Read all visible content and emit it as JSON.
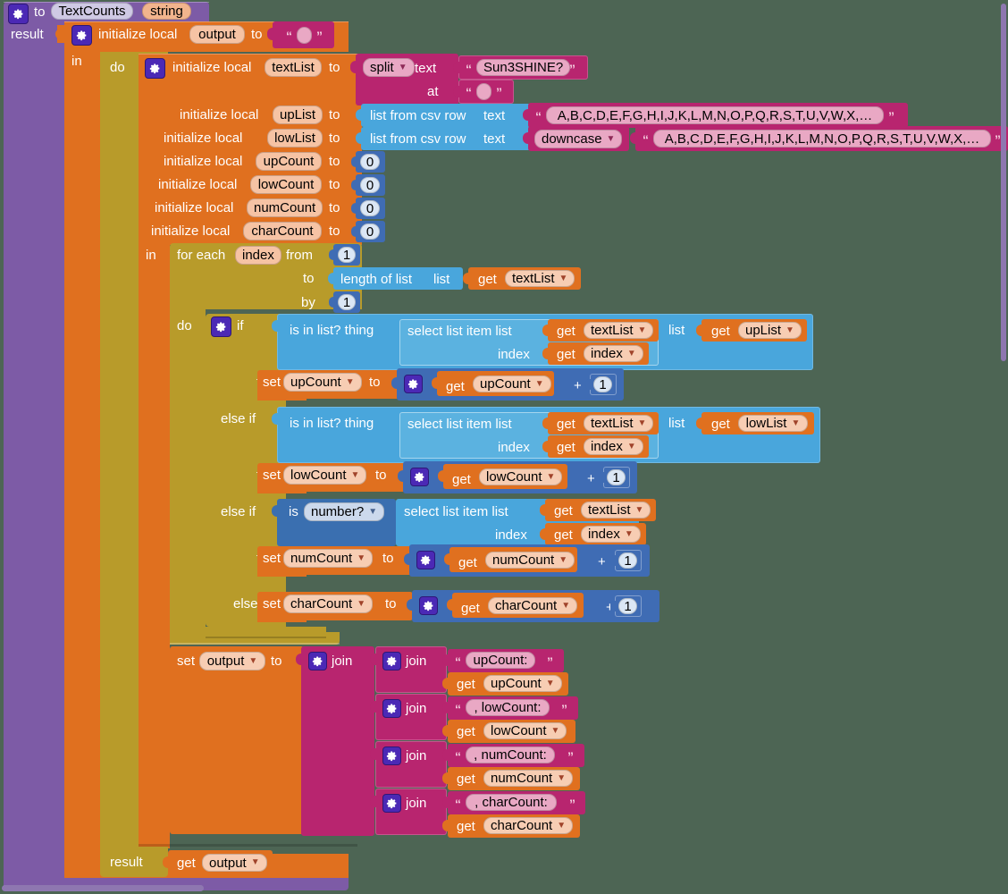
{
  "workspace": {
    "background_color": "#4d6554",
    "kind": "mit-app-inventor-blocks-editor"
  },
  "colors": {
    "procedure_purple": "#7d5ba6",
    "variable_orange": "#e0701f",
    "control_gold": "#b89b2a",
    "list_blue": "#49a6dc",
    "text_magenta": "#b8256f",
    "math_blue": "#3f6cb4",
    "logic_blue": "#3a6fb0",
    "mutator_gear": "#4b29b5"
  },
  "procedure": {
    "gear_icon": "gear-icon",
    "to_label": "to",
    "name": "TextCounts",
    "type_badge": "string",
    "result_label": "result"
  },
  "init_output": {
    "gear_icon": "gear-icon",
    "label": "initialize local",
    "var_name": "output",
    "to_label": "to",
    "value_text": "",
    "in_label": "in",
    "do_label": "do"
  },
  "init_textList": {
    "gear_icon": "gear-icon",
    "label": "initialize local",
    "var_name": "textList",
    "to_label": "to",
    "split": {
      "op": "split",
      "text_label": "text",
      "text_value": "Sun3SHINE?",
      "at_label": "at",
      "at_value": ""
    }
  },
  "init_upList": {
    "label": "initialize local",
    "var_name": "upList",
    "to_label": "to",
    "csv": {
      "block_label": "list from csv row",
      "text_label": "text",
      "value": "A,B,C,D,E,F,G,H,I,J,K,L,M,N,O,P,Q,R,S,T,U,V,W,X,…"
    }
  },
  "init_lowList": {
    "label": "initialize local",
    "var_name": "lowList",
    "to_label": "to",
    "csv": {
      "block_label": "list from csv row",
      "text_label": "text",
      "downcase_op": "downcase",
      "value": "A,B,C,D,E,F,G,H,I,J,K,L,M,N,O,P,Q,R,S,T,U,V,W,X,…"
    }
  },
  "counters": [
    {
      "label": "initialize local",
      "var_name": "upCount",
      "to_label": "to",
      "value": "0"
    },
    {
      "label": "initialize local",
      "var_name": "lowCount",
      "to_label": "to",
      "value": "0"
    },
    {
      "label": "initialize local",
      "var_name": "numCount",
      "to_label": "to",
      "value": "0"
    },
    {
      "label": "initialize local",
      "var_name": "charCount",
      "to_label": "to",
      "value": "0"
    }
  ],
  "for_each": {
    "in_label": "in",
    "for_each_label": "for each",
    "index_var": "index",
    "from_label": "from",
    "from_value": "1",
    "to_label": "to",
    "length_block": "length of list",
    "length_list_label": "list",
    "length_get": "get",
    "length_get_var": "textList",
    "by_label": "by",
    "by_value": "1",
    "do_label": "do"
  },
  "if_block": {
    "gear_icon": "gear-icon",
    "if_label": "if",
    "then_label": "then",
    "elseif_label": "else if",
    "else_label": "else",
    "branches": [
      {
        "test_type": "is-in-list",
        "test_label": "is in list? thing",
        "select_block": "select list item  list",
        "select_get": "get",
        "select_get_var": "textList",
        "index_label": "index",
        "index_get": "get",
        "index_get_var": "index",
        "list_label": "list",
        "list_get": "get",
        "list_get_var": "upList",
        "action_set": "set",
        "action_var": "upCount",
        "action_to": "to",
        "math_gear": "gear-icon",
        "math_get": "get",
        "math_get_var": "upCount",
        "math_op": "+",
        "math_rhs": "1"
      },
      {
        "test_type": "is-in-list",
        "test_label": "is in list? thing",
        "select_block": "select list item  list",
        "select_get": "get",
        "select_get_var": "textList",
        "index_label": "index",
        "index_get": "get",
        "index_get_var": "index",
        "list_label": "list",
        "list_get": "get",
        "list_get_var": "lowList",
        "action_set": "set",
        "action_var": "lowCount",
        "action_to": "to",
        "math_gear": "gear-icon",
        "math_get": "get",
        "math_get_var": "lowCount",
        "math_op": "+",
        "math_rhs": "1"
      },
      {
        "test_type": "is-number",
        "test_label": "is",
        "test_dropdown": "number?",
        "select_block": "select list item  list",
        "select_get": "get",
        "select_get_var": "textList",
        "index_label": "index",
        "index_get": "get",
        "index_get_var": "index",
        "action_set": "set",
        "action_var": "numCount",
        "action_to": "to",
        "math_gear": "gear-icon",
        "math_get": "get",
        "math_get_var": "numCount",
        "math_op": "+",
        "math_rhs": "1"
      },
      {
        "test_type": "else",
        "action_set": "set",
        "action_var": "charCount",
        "action_to": "to",
        "math_gear": "gear-icon",
        "math_get": "get",
        "math_get_var": "charCount",
        "math_op": "+",
        "math_rhs": "1"
      }
    ]
  },
  "set_output": {
    "set_label": "set",
    "var_name": "output",
    "to_label": "to",
    "outer_join": {
      "gear_icon": "gear-icon",
      "label": "join"
    },
    "joins": [
      {
        "gear_icon": "gear-icon",
        "label": "join",
        "text": "upCount:",
        "get": "get",
        "get_var": "upCount"
      },
      {
        "gear_icon": "gear-icon",
        "label": "join",
        "text": ", lowCount:",
        "get": "get",
        "get_var": "lowCount"
      },
      {
        "gear_icon": "gear-icon",
        "label": "join",
        "text": ", numCount:",
        "get": "get",
        "get_var": "numCount"
      },
      {
        "gear_icon": "gear-icon",
        "label": "join",
        "text": ", charCount:",
        "get": "get",
        "get_var": "charCount"
      }
    ]
  },
  "result_row": {
    "result_label": "result",
    "get": "get",
    "get_var": "output"
  }
}
